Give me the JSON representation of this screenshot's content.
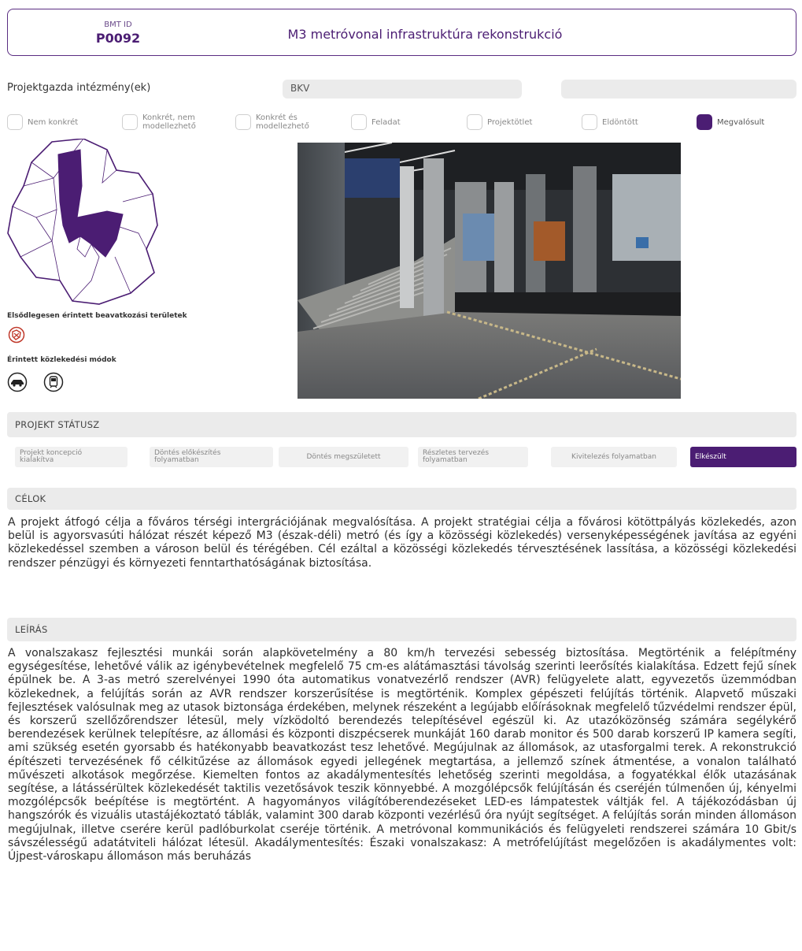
{
  "header": {
    "bmt_label": "BMT ID",
    "bmt_id": "P0092",
    "title": "M3 metróvonal infrastruktúra rekonstrukció"
  },
  "owner": {
    "label": "Projektgazda intézmény(ek)",
    "value1": "BKV",
    "value2": ""
  },
  "categories": [
    {
      "label": "Nem konkrét",
      "checked": false
    },
    {
      "label": "Konkrét, nem modellezhető",
      "checked": false
    },
    {
      "label": "Konkrét és modellezhető",
      "checked": false
    },
    {
      "label": "Feladat",
      "checked": false
    },
    {
      "label": "Projektötlet",
      "checked": false
    },
    {
      "label": "Eldöntött",
      "checked": false
    },
    {
      "label": "Megvalósult",
      "checked": true
    }
  ],
  "map_caption": "Elsődlegesen érintett beavatkozási területek",
  "modes_caption": "Érintett közlekedési módok",
  "icons": {
    "area": "area-icon",
    "mode1": "car-icon",
    "mode2": "metro-icon"
  },
  "status": {
    "title": "PROJEKT STÁTUSZ",
    "steps": [
      {
        "label": "Projekt koncepció kialakítva",
        "active": false
      },
      {
        "label": "Döntés előkészítés folyamatban",
        "active": false
      },
      {
        "label": "Döntés megszületett",
        "active": false
      },
      {
        "label": "Részletes tervezés folyamatban",
        "active": false
      },
      {
        "label": "Kivitelezés folyamatban",
        "active": false
      },
      {
        "label": "Elkészült",
        "active": true
      }
    ]
  },
  "goals": {
    "title": "CÉLOK",
    "text": "A projekt átfogó célja a főváros térségi intergrációjának megvalósítása. A projekt stratégiai célja a fővárosi kötöttpályás közlekedés, azon belül is agyorsvasúti hálózat részét képező M3 (észak-déli) metró (és így a közösségi közlekedés) versenyképességének javítása az egyéni közlekedéssel szemben a városon belül és térégében. Cél ezáltal a közösségi közlekedés térvesztésének lassítása, a közösségi közlekedési rendszer pénzügyi és környezeti fenntarthatóságának biztosítása."
  },
  "description": {
    "title": "LEÍRÁS",
    "text": "A vonalszakasz fejlesztési munkái során alapkövetelmény a 80 km/h tervezési sebesség biztosítása. Megtörténik a felépítmény egységesítése, lehetővé válik az igénybevételnek megfelelő 75 cm-es alátámasztási távolság szerinti leerősítés kialakítása. Edzett fejű sínek épülnek be. A 3-as metró szerelvényei 1990 óta automatikus vonatvezérlő rendszer (AVR) felügyelete alatt, egyvezetős üzemmódban közlekednek, a felújítás során az AVR rendszer korszerűsítése is megtörténik. Komplex gépészeti felújítás történik. Alapvető műszaki fejlesztések valósulnak meg az utasok biztonsága érdekében, melynek részeként a legújabb előírásoknak megfelelő tűzvédelmi rendszer épül, és korszerű szellőzőrendszer létesül, mely vízködoltó berendezés telepítésével egészül ki. Az utazóközönség számára segélykérő berendezések kerülnek telepítésre, az állomási és központi diszpécserek munkáját 160 darab monitor és 500 darab korszerű IP kamera segíti, ami szükség esetén gyorsabb és hatékonyabb beavatkozást tesz lehetővé. Megújulnak az állomások, az utasforgalmi terek. A rekonstrukció építészeti tervezésének fő célkitűzése az állomások egyedi jellegének megtartása, a jellemző színek átmentése, a vonalon található művészeti alkotások megőrzése. Kiemelten fontos az akadálymentesítés lehetőség szerinti megoldása, a fogyatékkal élők utazásának segítése, a látássérültek közlekedését taktilis vezetősávok teszik könnyebbé. A mozgólépcsők felújításán és cseréjén túlmenően új, kényelmi mozgólépcsők beépítése is megtörtént. A hagyományos világítóberendezéseket LED-es lámpatestek váltják fel. A tájékozódásban új hangszórók és vizuális utastájékoztató táblák, valamint 300 darab központi vezérlésű óra nyújt segítséget. A felújítás során minden állomáson megújulnak, illetve cserére kerül padlóburkolat cseréje történik. A metróvonal kommunikációs és felügyeleti rendszerei számára 10 Gbit/s sávszélességű adatátviteli hálózat létesül. Akadálymentesítés: Északi vonalszakasz: A metrófelújítást megelőzően is akadálymentes volt: Újpest-városkapu állomáson más beruházás"
  },
  "colors": {
    "accent": "#4b1d73",
    "bar": "#ebebeb"
  }
}
